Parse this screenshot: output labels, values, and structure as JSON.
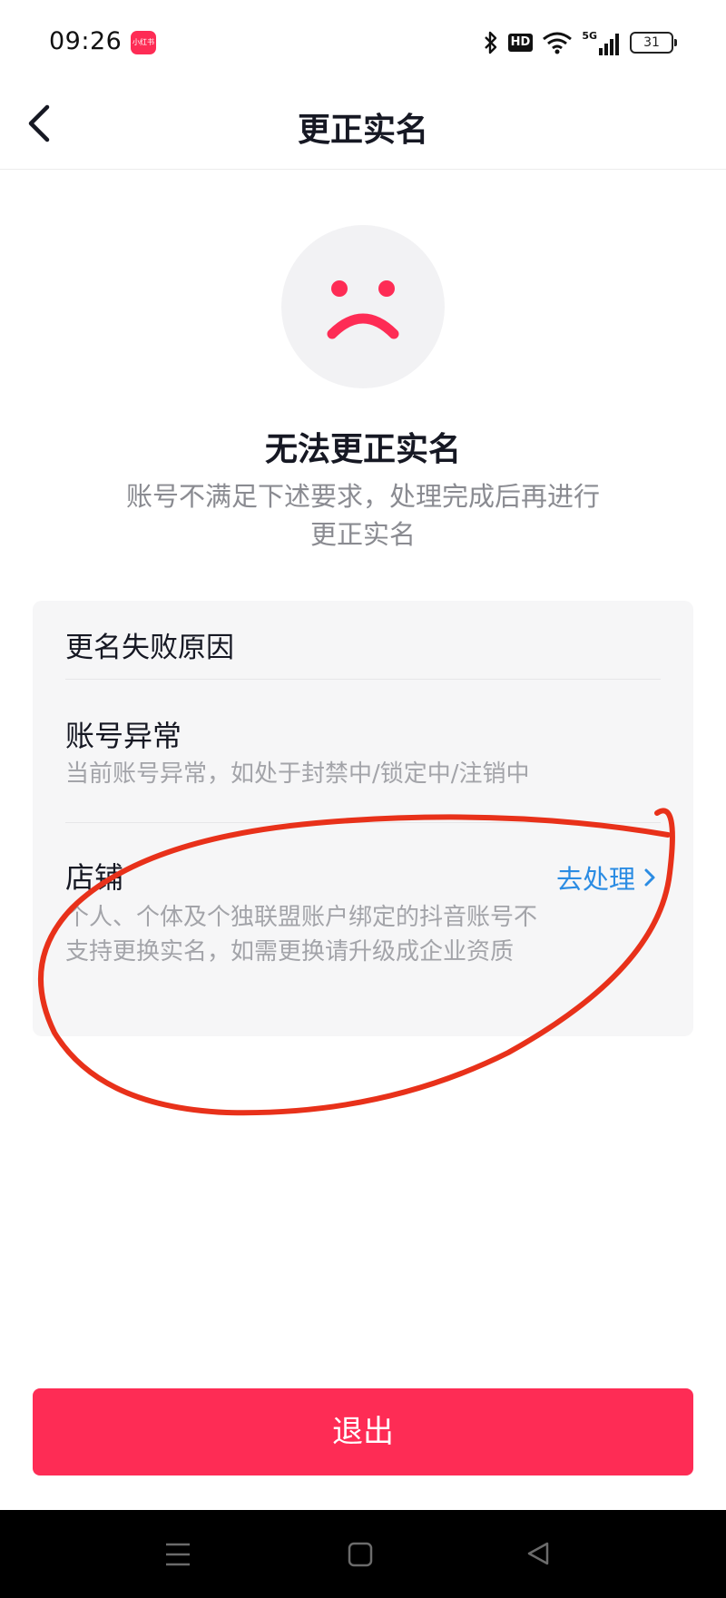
{
  "status_bar": {
    "time": "09:26",
    "app_badge": "小红书",
    "icons": [
      "bluetooth-icon",
      "hd-icon",
      "wifi-icon",
      "signal-5g-icon",
      "battery-icon"
    ],
    "network": "5G",
    "hd": "HD",
    "battery": "31"
  },
  "nav": {
    "title": "更正实名"
  },
  "error": {
    "title": "无法更正实名",
    "description": "账号不满足下述要求，处理完成后再进行更正实名"
  },
  "reasons": {
    "header": "更名失败原因",
    "items": [
      {
        "title": "账号异常",
        "description": "当前账号异常，如处于封禁中/锁定中/注销中"
      },
      {
        "title": "店铺",
        "description": "个人、个体及个独联盟账户绑定的抖音账号不支持更换实名，如需更换请升级成企业资质",
        "action": "去处理"
      }
    ]
  },
  "exit_label": "退出",
  "colors": {
    "accent": "#fe2c55",
    "link": "#2b8ce3",
    "annotation": "#e8311a"
  }
}
